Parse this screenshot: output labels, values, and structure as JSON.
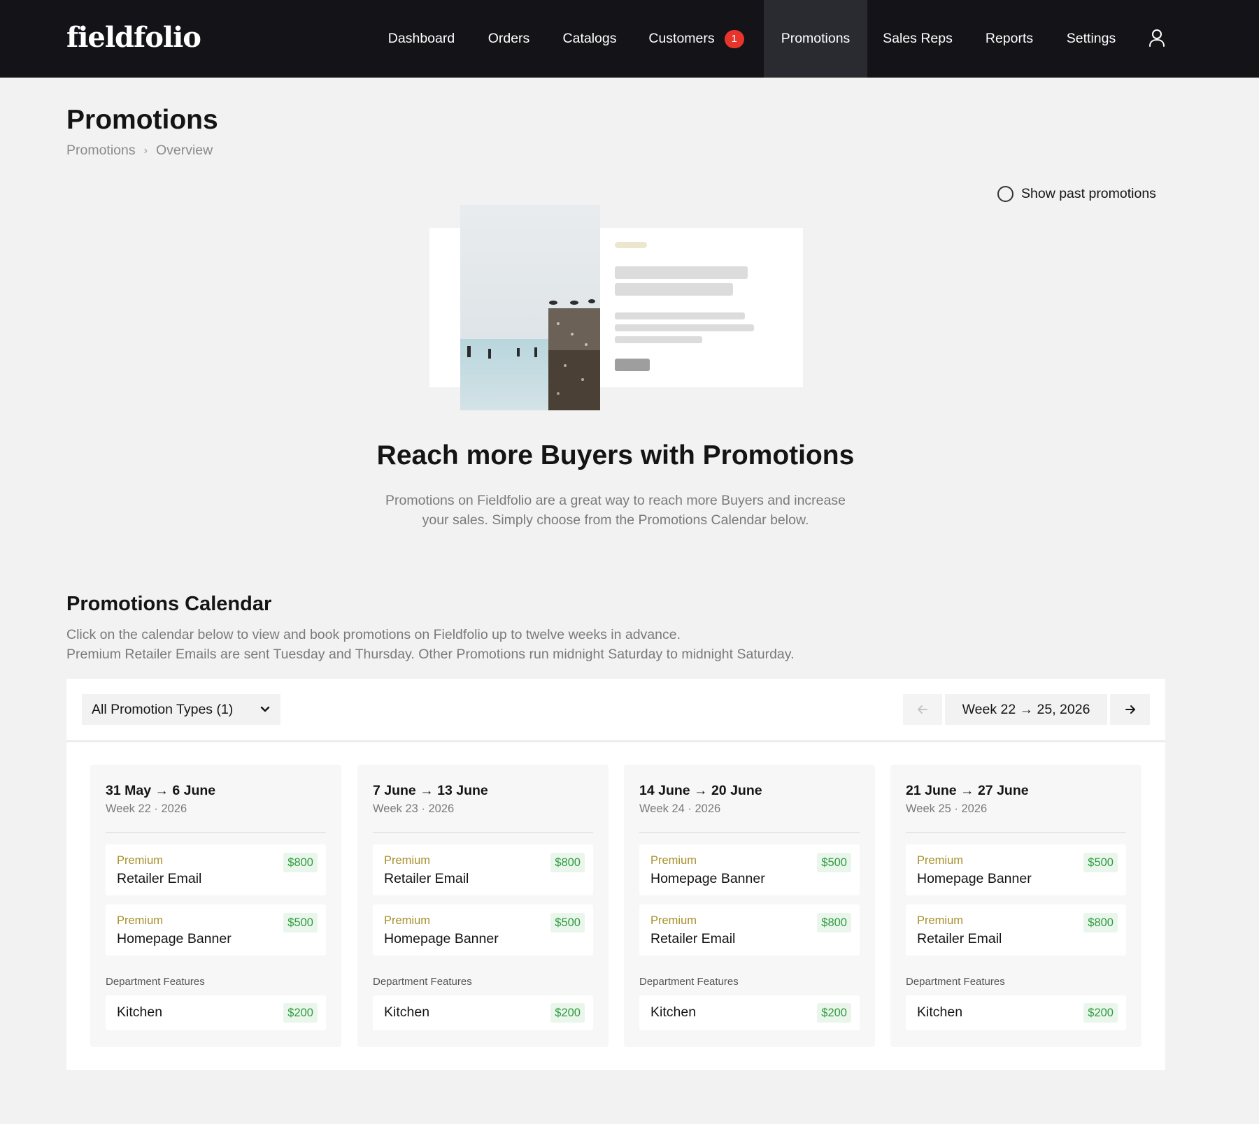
{
  "brand": {
    "logo": "fieldfolio"
  },
  "nav": {
    "items": [
      {
        "label": "Dashboard"
      },
      {
        "label": "Orders"
      },
      {
        "label": "Catalogs"
      },
      {
        "label": "Customers",
        "badge": "1"
      },
      {
        "label": "Promotions",
        "active": true
      },
      {
        "label": "Sales Reps"
      },
      {
        "label": "Reports"
      },
      {
        "label": "Settings"
      }
    ],
    "user_icon": "user-icon"
  },
  "header": {
    "title": "Promotions",
    "breadcrumb": [
      "Promotions",
      "Overview"
    ]
  },
  "toggle": {
    "label": "Show past promotions",
    "checked": false
  },
  "hero": {
    "title": "Reach more Buyers with Promotions",
    "text": "Promotions on Fieldfolio are a great way to reach more Buyers and increase your sales. Simply choose from the Promotions Calendar below."
  },
  "calendar": {
    "title": "Promotions Calendar",
    "desc1": "Click on the calendar below to view and book promotions on Fieldfolio up to twelve weeks in advance.",
    "desc2": "Premium Retailer Emails are sent Tuesday and Thursday. Other Promotions run midnight Saturday to midnight Saturday.",
    "filter_label": "All Promotion Types (1)",
    "week_range": "Week 22 → 25, 2026",
    "dept_label": "Department Features",
    "weeks": [
      {
        "range": "31 May → 6 June",
        "sub": "Week 22 · 2026",
        "slots": [
          {
            "tier": "Premium",
            "name": "Retailer Email",
            "price": "$800"
          },
          {
            "tier": "Premium",
            "name": "Homepage Banner",
            "price": "$500"
          }
        ],
        "dept": {
          "name": "Kitchen",
          "price": "$200"
        }
      },
      {
        "range": "7 June → 13 June",
        "sub": "Week 23 · 2026",
        "slots": [
          {
            "tier": "Premium",
            "name": "Retailer Email",
            "price": "$800"
          },
          {
            "tier": "Premium",
            "name": "Homepage Banner",
            "price": "$500"
          }
        ],
        "dept": {
          "name": "Kitchen",
          "price": "$200"
        }
      },
      {
        "range": "14 June → 20 June",
        "sub": "Week 24 · 2026",
        "slots": [
          {
            "tier": "Premium",
            "name": "Homepage Banner",
            "price": "$500"
          },
          {
            "tier": "Premium",
            "name": "Retailer Email",
            "price": "$800"
          }
        ],
        "dept": {
          "name": "Kitchen",
          "price": "$200"
        }
      },
      {
        "range": "21 June → 27 June",
        "sub": "Week 25 · 2026",
        "slots": [
          {
            "tier": "Premium",
            "name": "Homepage Banner",
            "price": "$500"
          },
          {
            "tier": "Premium",
            "name": "Retailer Email",
            "price": "$800"
          }
        ],
        "dept": {
          "name": "Kitchen",
          "price": "$200"
        }
      }
    ]
  },
  "colors": {
    "topbar": "#141418",
    "active_nav": "#2a2a31",
    "badge": "#e8352b",
    "premium": "#a68f2c",
    "price_text": "#2e9b3f",
    "price_bg": "#eaf6ec"
  }
}
